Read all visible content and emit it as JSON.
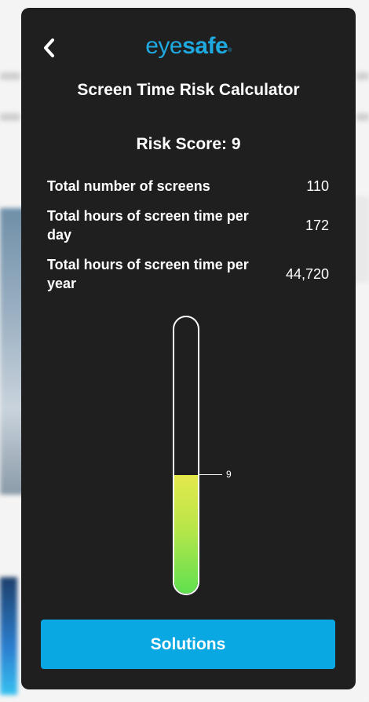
{
  "header": {
    "logo_part1": "eye",
    "logo_part2": "safe",
    "logo_mark": "®",
    "back_icon": "chevron-left-icon"
  },
  "title": "Screen Time Risk Calculator",
  "risk_score_label": "Risk Score: 9",
  "risk_score_value": 9,
  "stats": [
    {
      "label": "Total number of screens",
      "value": "110"
    },
    {
      "label": "Total hours of screen time per day",
      "value": "172"
    },
    {
      "label": "Total hours of screen time per year",
      "value": "44,720"
    }
  ],
  "gauge": {
    "marker_label": "9",
    "level_fraction": 0.43,
    "fill_colors": [
      "#e5e84b",
      "#5fe04f"
    ]
  },
  "solutions_label": "Solutions",
  "colors": {
    "panel": "#1f1f1f",
    "accent": "#0aa8e2",
    "logo": "#1ea9e1"
  }
}
